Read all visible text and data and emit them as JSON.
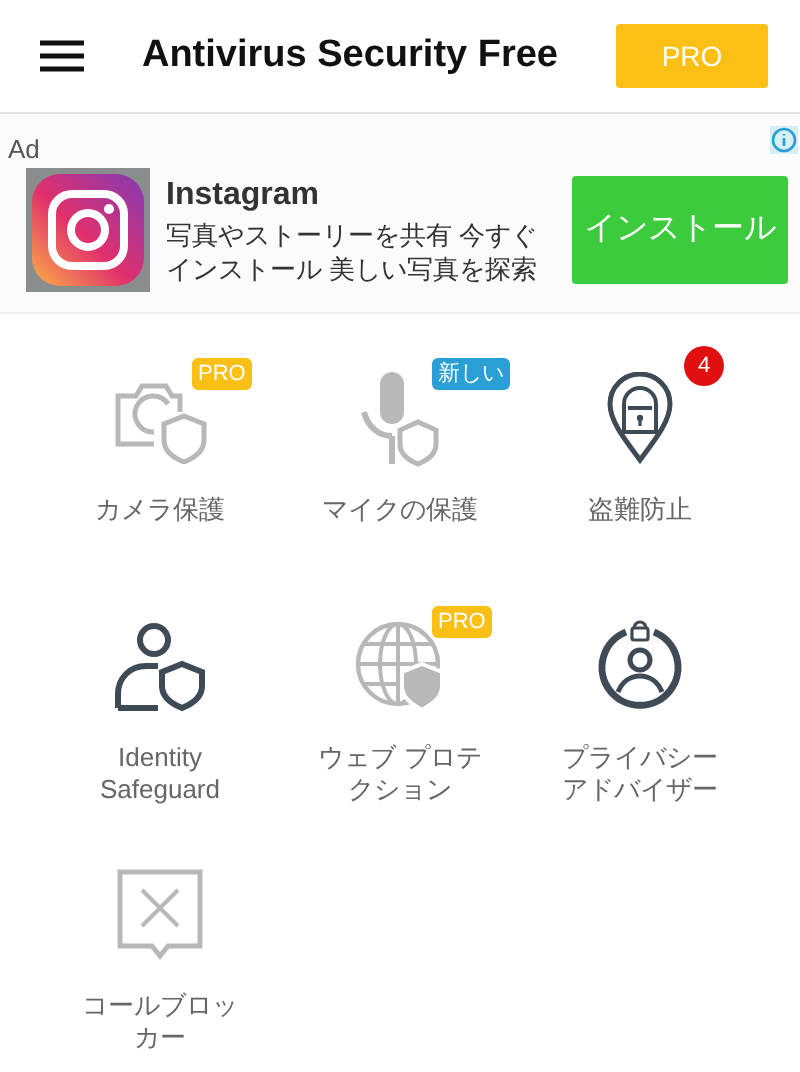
{
  "app_bar": {
    "title": "Antivirus Security Free",
    "pro_button": "PRO"
  },
  "ad": {
    "label": "Ad",
    "app_name": "Instagram",
    "description": "写真やストーリーを共有 今すぐインストール 美しい写真を探索",
    "install_button": "インストール"
  },
  "features": [
    {
      "label": "カメラ保護",
      "enabled": false,
      "badge": {
        "kind": "pro",
        "text": "PRO"
      }
    },
    {
      "label": "マイクの保護",
      "enabled": false,
      "badge": {
        "kind": "new",
        "text": "新しい"
      }
    },
    {
      "label": "盗難防止",
      "enabled": true,
      "badge": {
        "kind": "count",
        "text": "4"
      }
    },
    {
      "label": "Identity Safeguard",
      "enabled": true
    },
    {
      "label": "ウェブ プロテクション",
      "enabled": false,
      "badge": {
        "kind": "pro",
        "text": "PRO"
      }
    },
    {
      "label": "プライバシーアドバイザー",
      "enabled": true
    },
    {
      "label": "コールブロッカー",
      "enabled": false
    }
  ]
}
